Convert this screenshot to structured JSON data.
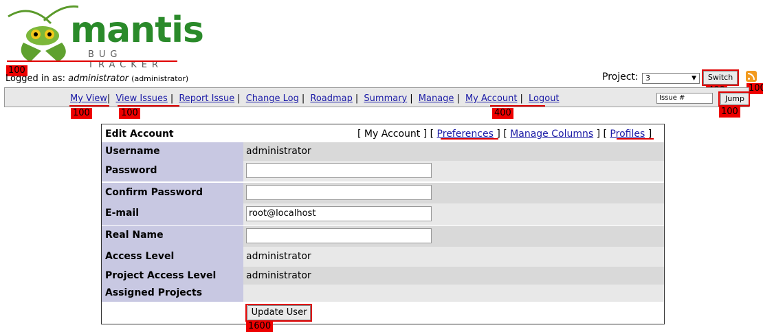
{
  "logo": {
    "word": "mantis",
    "sub": "BUG TRACKER"
  },
  "login": {
    "prefix": "Logged in as:",
    "user": "administrator",
    "role": "(administrator)"
  },
  "project": {
    "label": "Project:",
    "selected": "3",
    "switch_label": "Switch"
  },
  "menu": {
    "items": [
      "My View",
      "View Issues",
      "Report Issue",
      "Change Log",
      "Roadmap",
      "Summary",
      "Manage",
      "My Account",
      "Logout"
    ],
    "issue_placeholder": "Issue #",
    "jump_label": "Jump"
  },
  "form": {
    "title": "Edit Account",
    "links": [
      "My Account",
      "Preferences",
      "Manage Columns",
      "Profiles"
    ],
    "rows": [
      {
        "label": "Username",
        "value": "administrator"
      },
      {
        "label": "Password",
        "value": ""
      },
      {
        "label": "Confirm Password",
        "value": ""
      },
      {
        "label": "E-mail",
        "value": "root@localhost"
      },
      {
        "label": "Real Name",
        "value": ""
      },
      {
        "label": "Access Level",
        "value": "administrator"
      },
      {
        "label": "Project Access Level",
        "value": "administrator"
      },
      {
        "label": "Assigned Projects",
        "value": ""
      }
    ],
    "submit_label": "Update User"
  },
  "annotations": {
    "login_badge": "100",
    "myview_badge": "100",
    "viewissues_badge": "100",
    "myaccount_badge": "400",
    "switch_badge": "400",
    "rss_badge": "100",
    "jump_badge": "100",
    "preferences_badge": "400",
    "profiles_badge": "400",
    "update_badge": "1600"
  },
  "colors": {
    "label_bg": "#c8c8e2",
    "value_bg": "#d9d9d9",
    "menu_bg": "#e8e8e8",
    "annotation": "#ee0000",
    "logo_green": "#2a8a2a"
  }
}
